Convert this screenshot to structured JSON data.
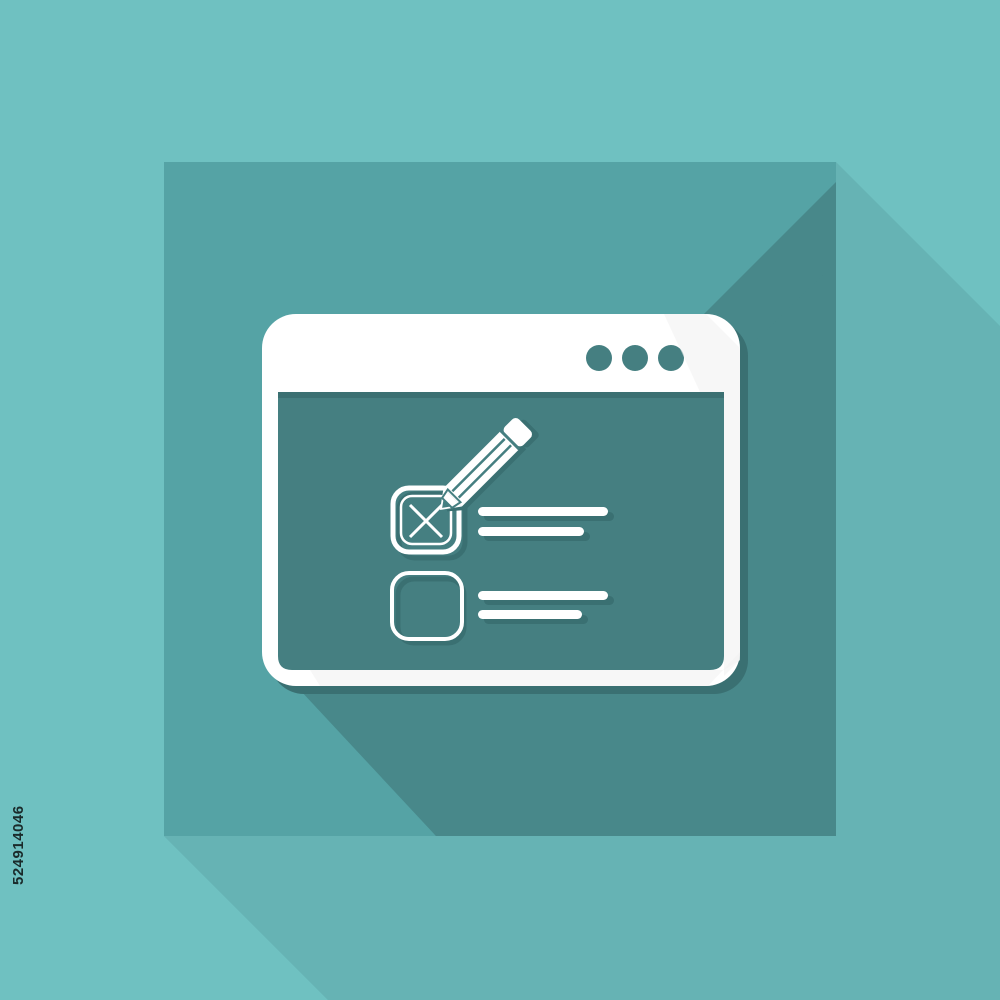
{
  "image_id_text": "524914046",
  "icon": {
    "name": "browser-checklist-edit-icon",
    "checklist": {
      "items": [
        {
          "state": "crossed"
        },
        {
          "state": "empty"
        }
      ]
    },
    "window_buttons_count": 3
  },
  "colors": {
    "background": "#6fc1c1",
    "tile": "#55a3a5",
    "long_shadow": "#48888a",
    "window_content": "#457f81",
    "white": "#ffffff",
    "stock_text": "#1a2a2a"
  }
}
